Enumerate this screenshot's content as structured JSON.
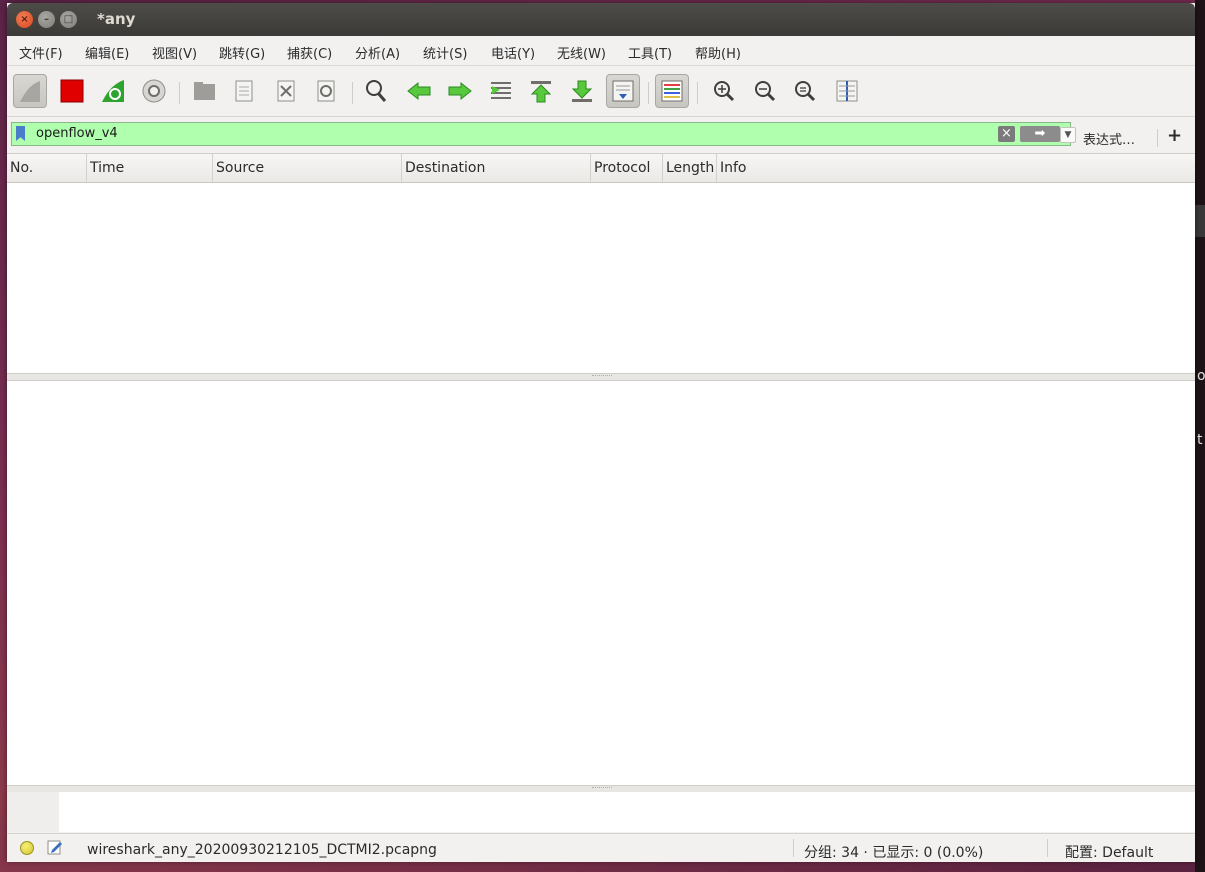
{
  "window": {
    "title": "*any"
  },
  "menu": [
    "文件(F)",
    "编辑(E)",
    "视图(V)",
    "跳转(G)",
    "捕获(C)",
    "分析(A)",
    "统计(S)",
    "电话(Y)",
    "无线(W)",
    "工具(T)",
    "帮助(H)"
  ],
  "toolbar_icons": [
    "shark-fin-start-icon",
    "stop-icon",
    "restart-capture-icon",
    "capture-options-icon",
    "open-file-icon",
    "save-file-icon",
    "close-file-icon",
    "reload-file-icon",
    "find-packet-icon",
    "go-back-icon",
    "go-forward-icon",
    "go-to-packet-icon",
    "first-packet-icon",
    "last-packet-icon",
    "autoscroll-icon",
    "colorize-icon",
    "zoom-in-icon",
    "zoom-out-icon",
    "normal-size-icon",
    "resize-columns-icon"
  ],
  "filter": {
    "value": "openflow_v4",
    "expression_label": "表达式…",
    "add_label": "+"
  },
  "packet_list": {
    "columns": [
      "No.",
      "Time",
      "Source",
      "Destination",
      "Protocol",
      "Length",
      "Info"
    ]
  },
  "status": {
    "file": "wireshark_any_20200930212105_DCTMI2.pcapng",
    "packets": "分组: 34 · 已显示: 0 (0.0%)",
    "profile": "配置: Default"
  },
  "colors": {
    "filter_valid_bg": "#afffaf",
    "stop_red": "#e00000",
    "shark_green": "#2fa32f"
  },
  "background_fragments": [
    "o",
    "t"
  ]
}
